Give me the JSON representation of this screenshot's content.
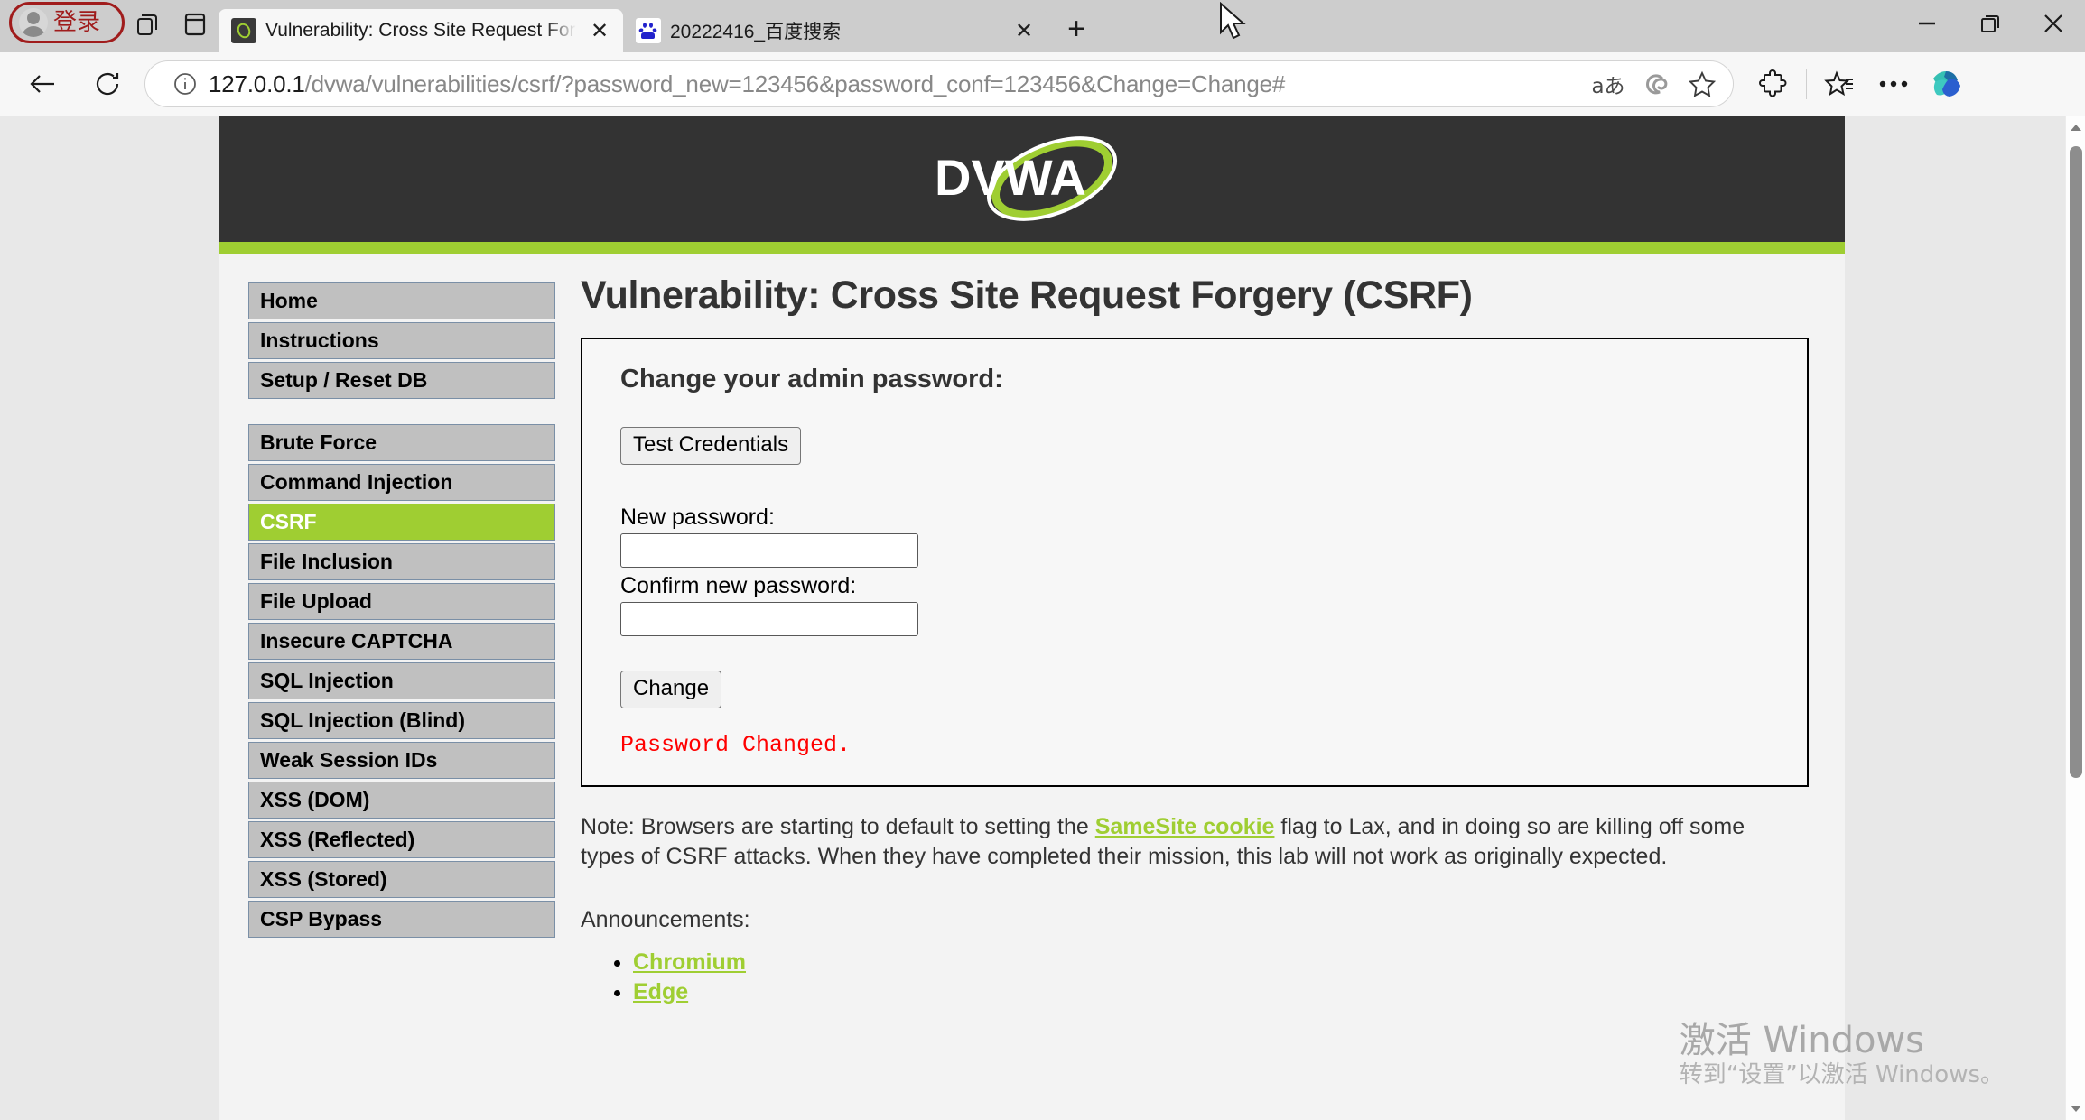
{
  "browser": {
    "profile_label": "登录",
    "tabs": [
      {
        "title": "Vulnerability: Cross Site Request Forgery (CSRF) - Damn Vulnerable Web Application (DVWA)",
        "favicon": "dvwa-favicon",
        "active": true,
        "close_label": "✕"
      },
      {
        "title": "20222416_百度搜索",
        "favicon": "baidu-favicon",
        "active": false,
        "close_label": "✕"
      }
    ],
    "newtab_label": "+",
    "window_controls": {
      "minimize": "minimize-icon",
      "restore": "restore-icon",
      "close": "close-icon"
    },
    "toolbar": {
      "back": "back-arrow-icon",
      "refresh": "refresh-icon",
      "site_info": "info-icon",
      "url_host": "127.0.0.1",
      "url_path": "/dvwa/vulnerabilities/csrf/?password_new=123456&password_conf=123456&Change=Change#",
      "url_full": "127.0.0.1/dvwa/vulnerabilities/csrf/?password_new=123456&password_conf=123456&Change=Change#",
      "read_aloud": "aあ",
      "copilot_omni": "copilot-swirl-icon",
      "favorite_star": "star-outline-icon",
      "extensions": "puzzle-icon",
      "collections": "collections-star-icon",
      "settings_more": "•••",
      "copilot_sidebar": "copilot-icon"
    }
  },
  "page": {
    "header_logo_text": "DVWA",
    "title": "Vulnerability: Cross Site Request Forgery (CSRF)",
    "sidebar": {
      "group1": [
        {
          "label": "Home",
          "active": false
        },
        {
          "label": "Instructions",
          "active": false
        },
        {
          "label": "Setup / Reset DB",
          "active": false
        }
      ],
      "group2": [
        {
          "label": "Brute Force",
          "active": false
        },
        {
          "label": "Command Injection",
          "active": false
        },
        {
          "label": "CSRF",
          "active": true
        },
        {
          "label": "File Inclusion",
          "active": false
        },
        {
          "label": "File Upload",
          "active": false
        },
        {
          "label": "Insecure CAPTCHA",
          "active": false
        },
        {
          "label": "SQL Injection",
          "active": false
        },
        {
          "label": "SQL Injection (Blind)",
          "active": false
        },
        {
          "label": "Weak Session IDs",
          "active": false
        },
        {
          "label": "XSS (DOM)",
          "active": false
        },
        {
          "label": "XSS (Reflected)",
          "active": false
        },
        {
          "label": "XSS (Stored)",
          "active": false
        },
        {
          "label": "CSP Bypass",
          "active": false
        }
      ]
    },
    "form": {
      "heading": "Change your admin password:",
      "test_credentials_label": "Test Credentials",
      "new_password_label": "New password:",
      "new_password_value": "",
      "confirm_password_label": "Confirm new password:",
      "confirm_password_value": "",
      "change_label": "Change",
      "status_message": "Password Changed.",
      "status_color": "#ff0000"
    },
    "note": {
      "prefix": "Note: Browsers are starting to default to setting the ",
      "link": "SameSite cookie",
      "suffix": " flag to Lax, and in doing so are killing off some types of CSRF attacks. When they have completed their mission, this lab will not work as originally expected."
    },
    "announcements_label": "Announcements:",
    "announcements": [
      {
        "label": "Chromium"
      },
      {
        "label": "Edge"
      }
    ],
    "colors": {
      "accent_green": "#9fce32",
      "header_dark": "#333333",
      "nav_button": "#c0c0c0",
      "status_red": "#ff0000"
    }
  },
  "watermark": {
    "line1": "激活 Windows",
    "line2": "转到“设置”以激活 Windows。"
  },
  "scrollbar": {
    "up_arrow": "scroll-up-arrow",
    "down_arrow": "scroll-down-arrow"
  }
}
